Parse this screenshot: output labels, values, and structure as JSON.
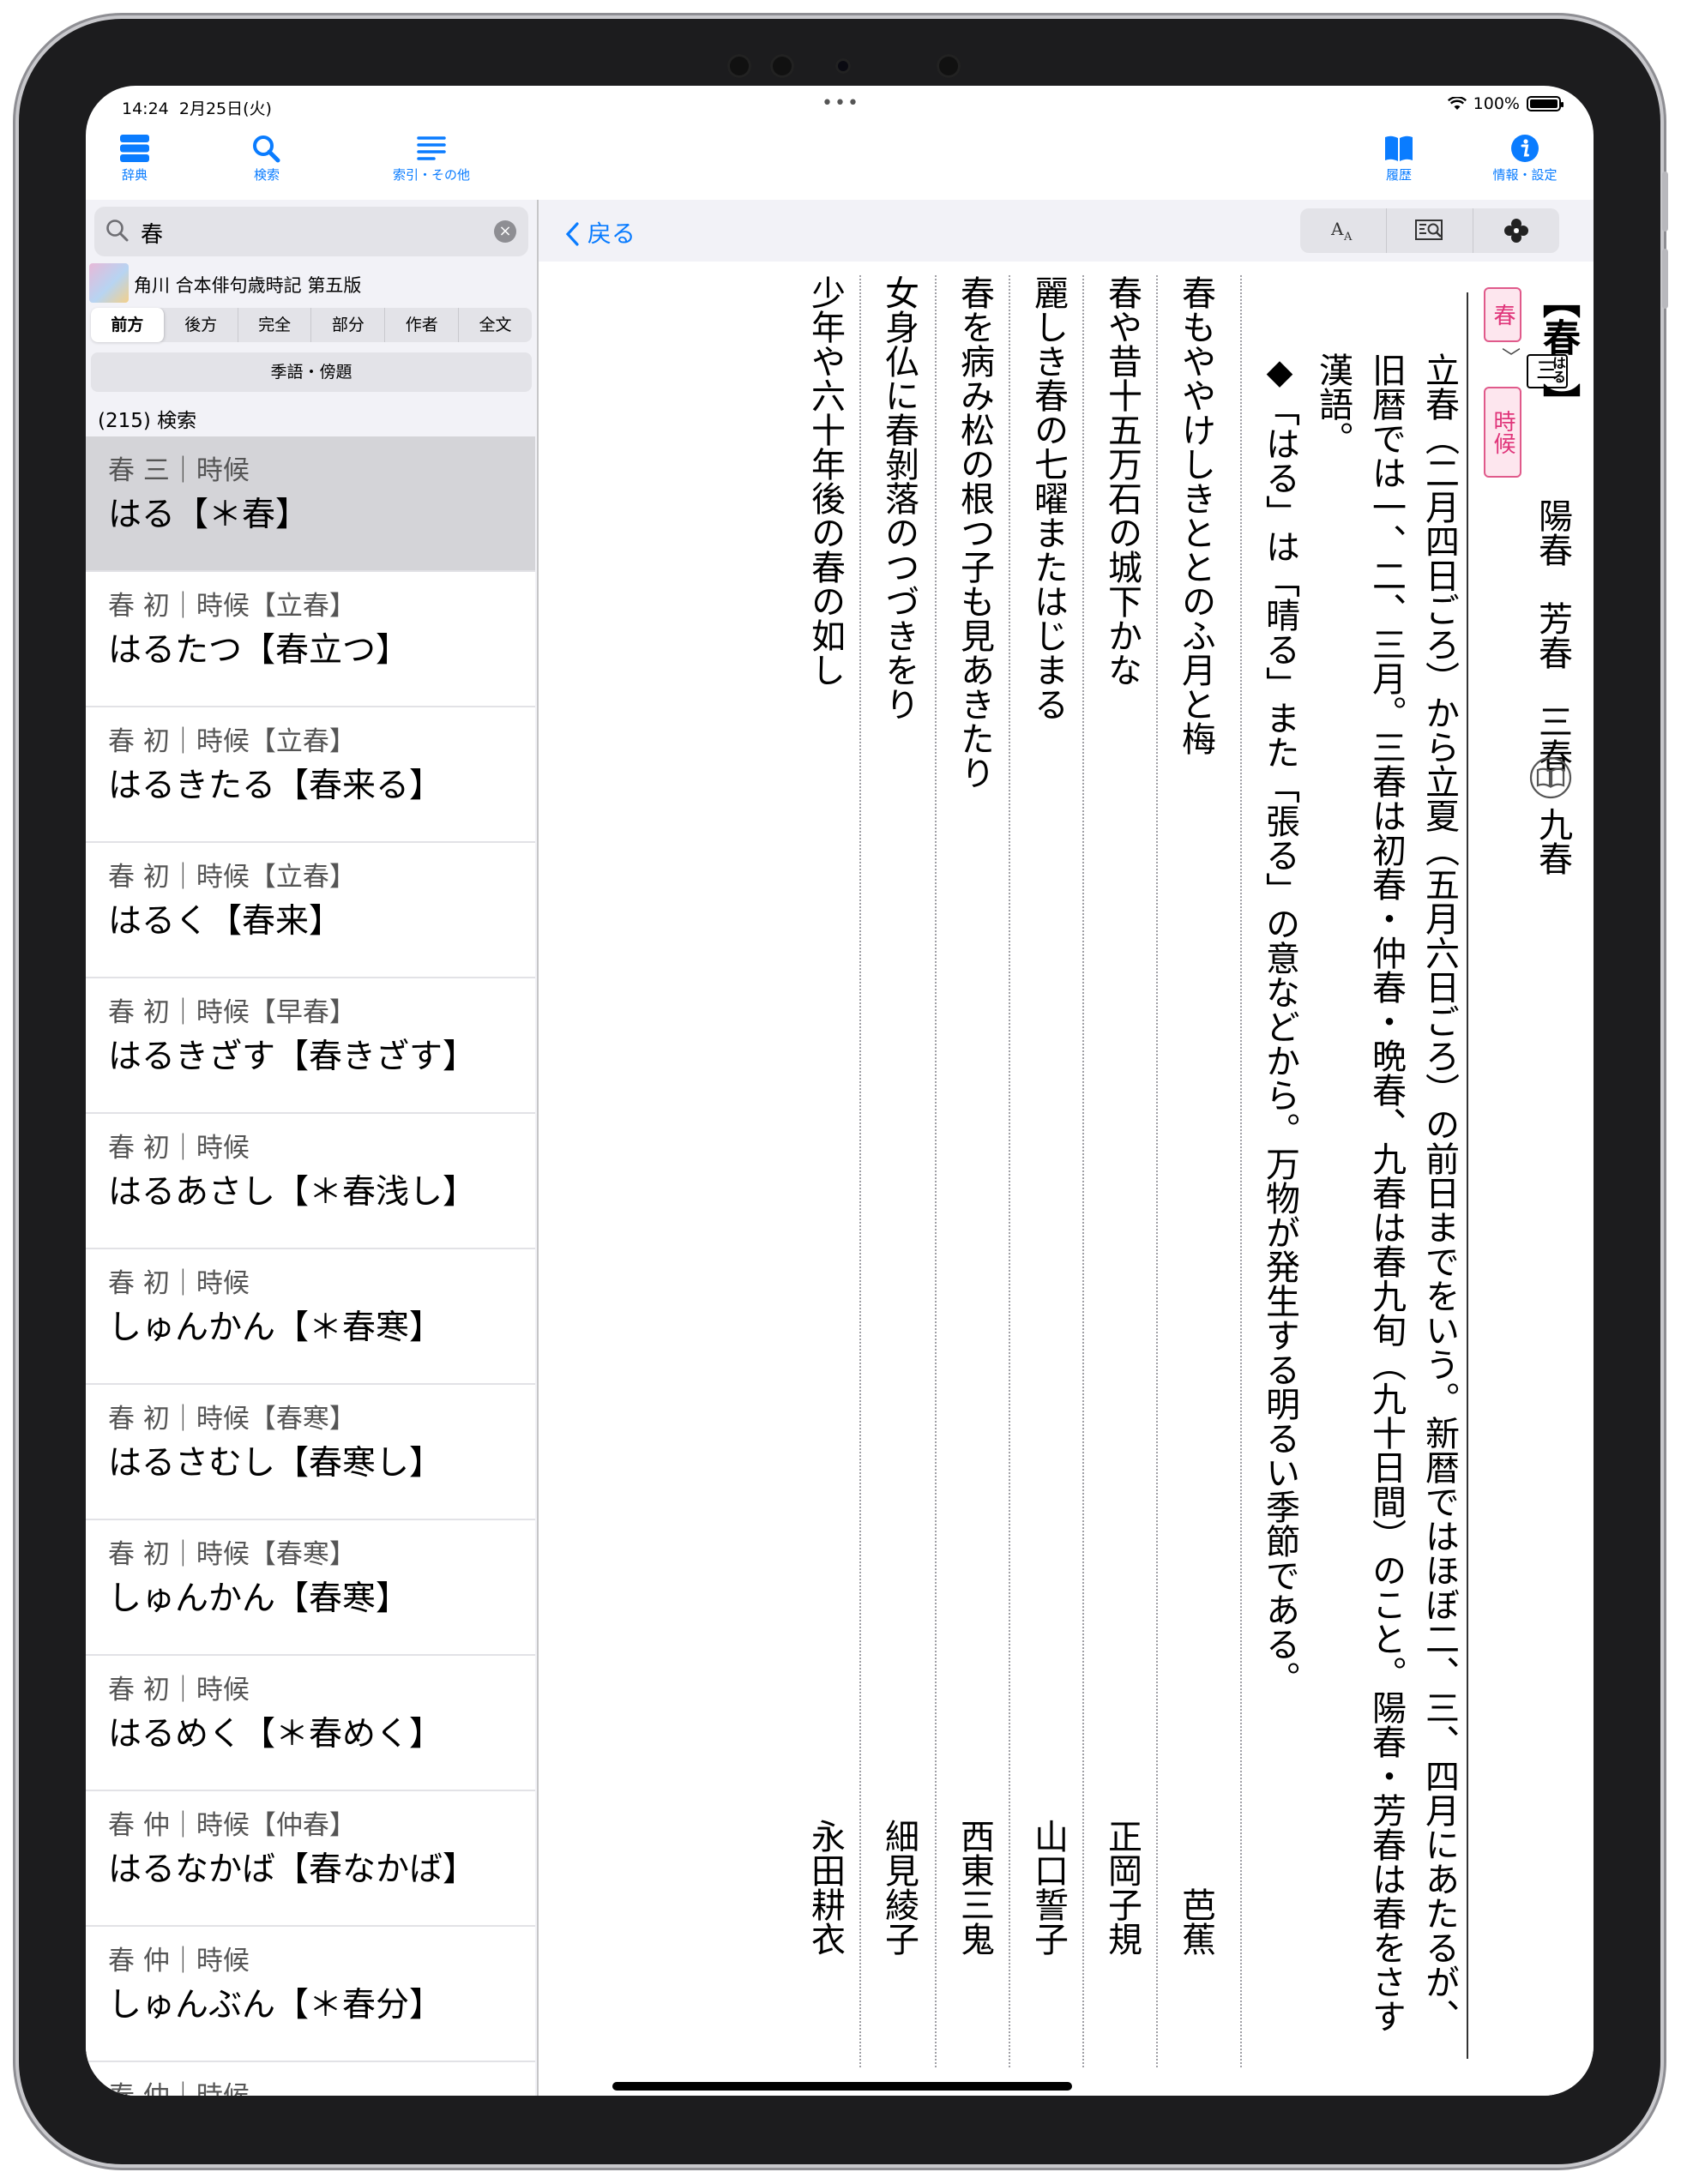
{
  "status": {
    "time": "14:24",
    "date": "2月25日(火)",
    "dots": "•••",
    "battery": "100%",
    "battery_level": 1.0
  },
  "toolbar": {
    "dict": "辞典",
    "search": "検索",
    "index": "索引・その他",
    "history": "履歴",
    "settings": "情報・設定"
  },
  "sidebar": {
    "search_value": "春",
    "dictionary": "角川 合本俳句歳時記 第五版",
    "modes": [
      "前方",
      "後方",
      "完全",
      "部分",
      "作者",
      "全文"
    ],
    "active_mode": "前方",
    "kigo_button": "季語・傍題",
    "count": "(215) 検索",
    "results": [
      {
        "meta": "春 三｜時候",
        "head": "はる【＊春】",
        "selected": true
      },
      {
        "meta": "春 初｜時候【立春】",
        "head": "はるたつ【春立つ】"
      },
      {
        "meta": "春 初｜時候【立春】",
        "head": "はるきたる【春来る】"
      },
      {
        "meta": "春 初｜時候【立春】",
        "head": "はるく【春来】"
      },
      {
        "meta": "春 初｜時候【早春】",
        "head": "はるきざす【春きざす】"
      },
      {
        "meta": "春 初｜時候",
        "head": "はるあさし【＊春浅し】"
      },
      {
        "meta": "春 初｜時候",
        "head": "しゅんかん【＊春寒】"
      },
      {
        "meta": "春 初｜時候【春寒】",
        "head": "はるさむし【春寒し】"
      },
      {
        "meta": "春 初｜時候【春寒】",
        "head": "しゅんかん【春寒】"
      },
      {
        "meta": "春 初｜時候",
        "head": "はるめく【＊春めく】"
      },
      {
        "meta": "春 仲｜時候【仲春】",
        "head": "はるなかば【春なかば】"
      },
      {
        "meta": "春 仲｜時候",
        "head": "しゅんぶん【＊春分】"
      },
      {
        "meta": "春 仲｜時候",
        "head": ""
      }
    ]
  },
  "detail": {
    "back": "戻る",
    "tools": [
      "font-size-icon",
      "search-in-page-icon",
      "shortcut-icon"
    ],
    "headword_open": "【",
    "headword": "春",
    "headword_ruby": "はる",
    "headword_close": "】",
    "season_tag": "春",
    "arrow": "〉",
    "category_tag": "時候",
    "period_box": "三",
    "aliases": "陽春　芳春　三春　九春",
    "paragraphs": [
      "立春（二月四日ごろ）から立夏（五月六日ごろ）の前日までをいう。新暦ではほぼ二、三、四月にあたるが、",
      "旧暦では一、二、三月。三春は初春・仲春・晩春、九春は春九旬（九十日間）のこと。陽春・芳春は春をさす",
      "漢語。",
      "◆「はる」は「晴る」また「張る」の意などから。万物が発生する明るい季節である。"
    ],
    "haiku": [
      {
        "text": "春もややけしきととのふ月と梅",
        "author": "芭蕉"
      },
      {
        "text": "春や昔十五万石の城下かな",
        "author": "正岡子規"
      },
      {
        "text": "麗しき春の七曜またはじまる",
        "author": "山口誓子"
      },
      {
        "text": "春を病み松の根つ子も見あきたり",
        "author": "西東三鬼"
      },
      {
        "text": "女身仏に春剝落のつづきをり",
        "author": "細見綾子"
      },
      {
        "text": "少年や六十年後の春の如し",
        "author": "永田耕衣"
      }
    ]
  }
}
